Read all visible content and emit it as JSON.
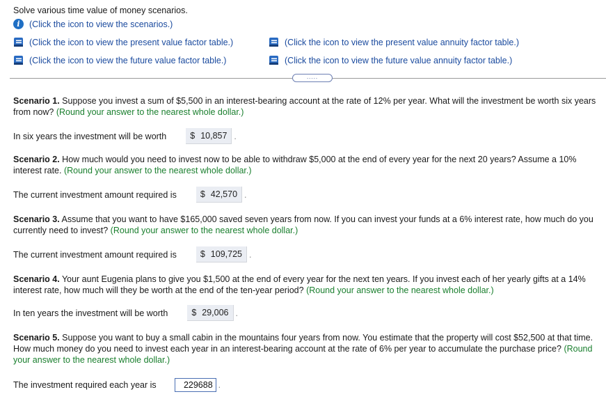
{
  "header": {
    "instruction": "Solve various time value of money scenarios.",
    "links": {
      "scenarios": "(Click the icon to view the scenarios.)",
      "pv_factor": "(Click the icon to view the present value factor table.)",
      "fv_factor": "(Click the icon to view the future value factor table.)",
      "pv_annuity": "(Click the icon to view the present value annuity factor table.)",
      "fv_annuity": "(Click the icon to view the future value annuity factor table.)"
    },
    "expander_label": "....."
  },
  "scenarios": [
    {
      "title": "Scenario 1.",
      "text": " Suppose you invest a sum of $5,500 in an interest-bearing account at the rate of 12% per year. What will the investment be worth six years from now? ",
      "hint": "(Round your answer to the nearest whole dollar.)",
      "answer_label": "In six years the investment will be worth",
      "currency": "$",
      "answer": "10,857"
    },
    {
      "title": "Scenario 2.",
      "text": " How much would you need to invest now to be able to withdraw $5,000 at the end of every year for the next 20 years? Assume a 10% interest rate. ",
      "hint": "(Round your answer to the nearest whole dollar.)",
      "answer_label": "The current investment amount required is",
      "currency": "$",
      "answer": "42,570"
    },
    {
      "title": "Scenario 3.",
      "text": " Assume that you want to have $165,000 saved seven years from now. If you can invest your funds at a 6% interest rate, how much do you currently need to invest? ",
      "hint": "(Round your answer to the nearest whole dollar.)",
      "answer_label": "The current investment amount required is",
      "currency": "$",
      "answer": "109,725"
    },
    {
      "title": "Scenario 4.",
      "text": " Your aunt Eugenia plans to give you $1,500 at the end of every year for the next ten years. If you invest each of her yearly gifts at a 14% interest rate, how much will they be worth at the end of the ten-year period? ",
      "hint": "(Round your answer to the nearest whole dollar.)",
      "answer_label": "In ten years the investment will be worth",
      "currency": "$",
      "answer": "29,006"
    },
    {
      "title": "Scenario 5.",
      "text": " Suppose you want to buy a small cabin in the mountains four years from now. You estimate that the property will cost $52,500 at that time. How much money do you need to invest each year in an interest-bearing account at the rate of 6% per year to accumulate the purchase price? ",
      "hint": "(Round your answer to the nearest whole dollar.)",
      "answer_label": "The investment required each year is",
      "input_value": "229688"
    }
  ],
  "period": "."
}
